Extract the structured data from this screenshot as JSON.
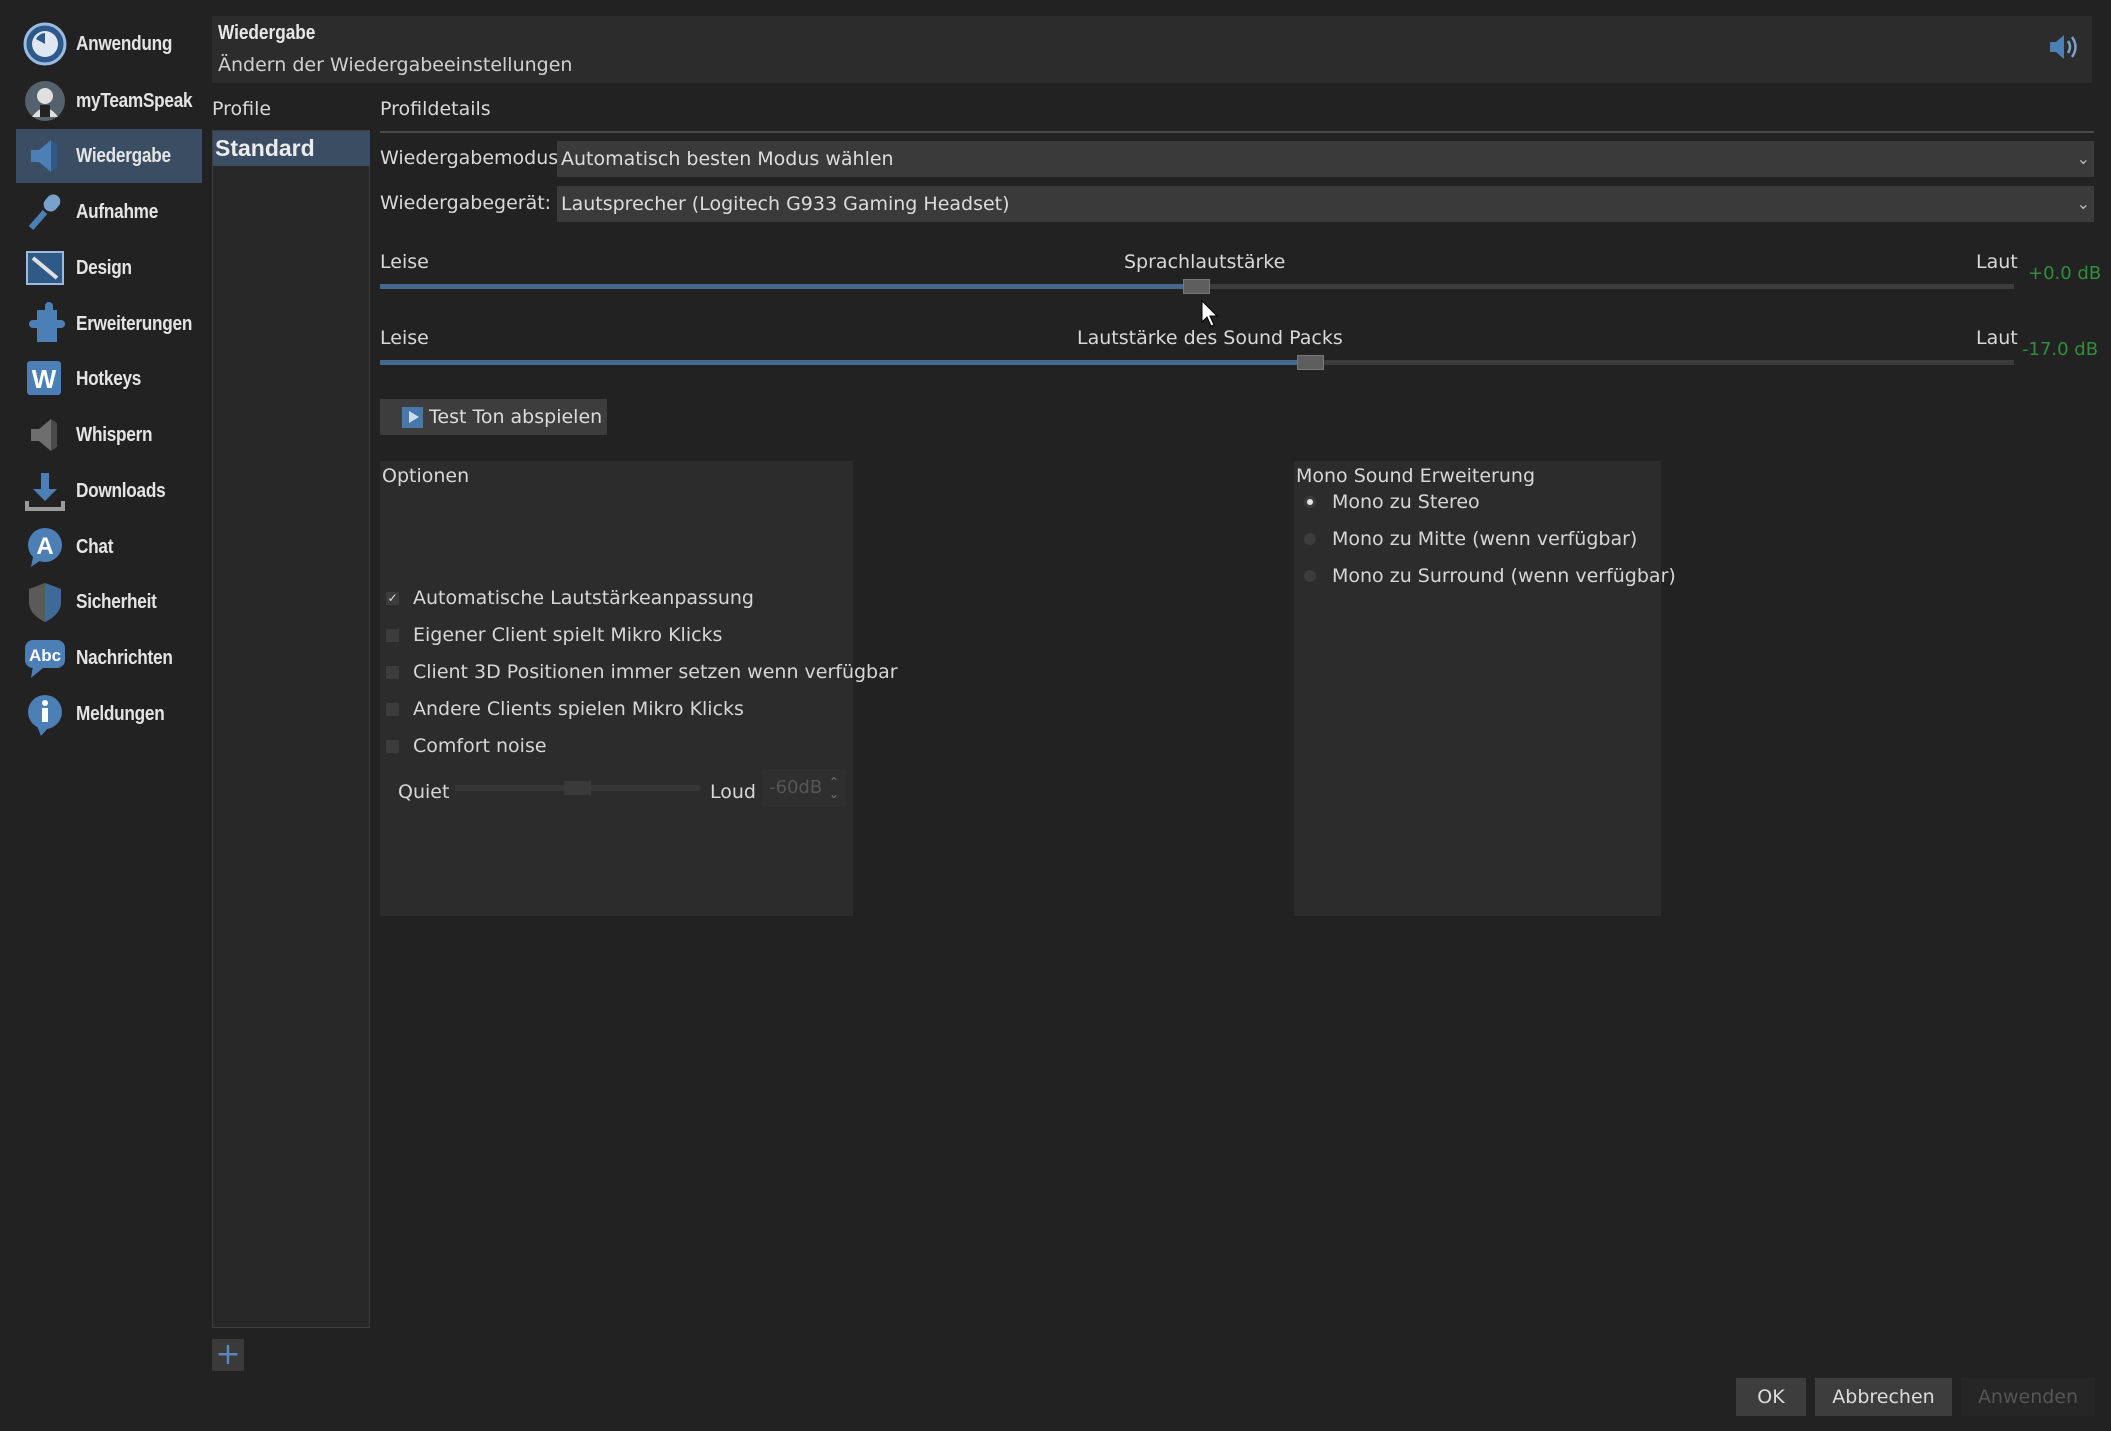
{
  "sidebar": {
    "items": [
      {
        "label": "Anwendung",
        "icon": "clock-icon"
      },
      {
        "label": "myTeamSpeak",
        "icon": "user-icon"
      },
      {
        "label": "Wiedergabe",
        "icon": "speaker-icon",
        "active": true
      },
      {
        "label": "Aufnahme",
        "icon": "microphone-icon"
      },
      {
        "label": "Design",
        "icon": "design-icon"
      },
      {
        "label": "Erweiterungen",
        "icon": "puzzle-icon"
      },
      {
        "label": "Hotkeys",
        "icon": "keyboard-icon"
      },
      {
        "label": "Whispern",
        "icon": "whisper-icon"
      },
      {
        "label": "Downloads",
        "icon": "download-icon"
      },
      {
        "label": "Chat",
        "icon": "chat-icon"
      },
      {
        "label": "Sicherheit",
        "icon": "shield-icon"
      },
      {
        "label": "Nachrichten",
        "icon": "messages-icon"
      },
      {
        "label": "Meldungen",
        "icon": "info-icon"
      }
    ]
  },
  "header": {
    "title": "Wiedergabe",
    "subtitle": "Ändern der Wiedergabeeinstellungen"
  },
  "profiles": {
    "label": "Profile",
    "items": [
      "Standard"
    ],
    "add_label": "+"
  },
  "details": {
    "label": "Profildetails",
    "mode_label": "Wiedergabemodus:",
    "mode_value": "Automatisch besten Modus wählen",
    "device_label": "Wiedergabegerät:",
    "device_value": "Lautsprecher (Logitech G933 Gaming Headset)",
    "voice_slider": {
      "left": "Leise",
      "title": "Sprachlautstärke",
      "right": "Laut",
      "db": "+0.0 dB",
      "level": 0.5
    },
    "pack_slider": {
      "left": "Leise",
      "title": "Lautstärke des Sound Packs",
      "right": "Laut",
      "db": "-17.0 dB",
      "level": 0.57
    },
    "test_button": "Test Ton abspielen"
  },
  "options": {
    "title": "Optionen",
    "checkboxes": [
      {
        "label": "Automatische Lautstärkeanpassung",
        "checked": true
      },
      {
        "label": "Eigener Client spielt Mikro Klicks",
        "checked": false
      },
      {
        "label": "Client 3D Positionen immer setzen wenn verfügbar",
        "checked": false
      },
      {
        "label": "Andere Clients spielen Mikro Klicks",
        "checked": false
      },
      {
        "label": "Comfort noise",
        "checked": false
      }
    ],
    "noise_quiet": "Quiet",
    "noise_loud": "Loud",
    "noise_value": "-60dB",
    "noise_level": 0.5
  },
  "mono": {
    "title": "Mono Sound Erweiterung",
    "radios": [
      {
        "label": "Mono zu Stereo",
        "selected": true
      },
      {
        "label": "Mono zu Mitte (wenn verfügbar)",
        "selected": false
      },
      {
        "label": "Mono zu Surround (wenn verfügbar)",
        "selected": false
      }
    ]
  },
  "buttons": {
    "ok": "OK",
    "cancel": "Abbrechen",
    "apply": "Anwenden"
  }
}
